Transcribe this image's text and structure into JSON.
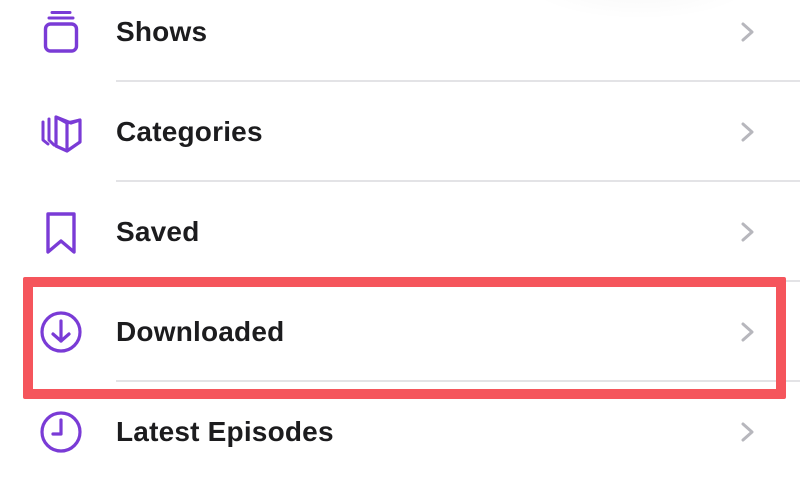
{
  "colors": {
    "accent": "#7a3bd6",
    "chevron": "#b7b7bd",
    "divider": "#e3e3e6",
    "highlight": "#f5555c"
  },
  "menu": {
    "items": [
      {
        "label": "Shows",
        "icon": "shows-stack-icon"
      },
      {
        "label": "Categories",
        "icon": "categories-cards-icon"
      },
      {
        "label": "Saved",
        "icon": "bookmark-icon"
      },
      {
        "label": "Downloaded",
        "icon": "download-circle-icon",
        "highlighted": true
      },
      {
        "label": "Latest Episodes",
        "icon": "clock-icon"
      }
    ]
  }
}
